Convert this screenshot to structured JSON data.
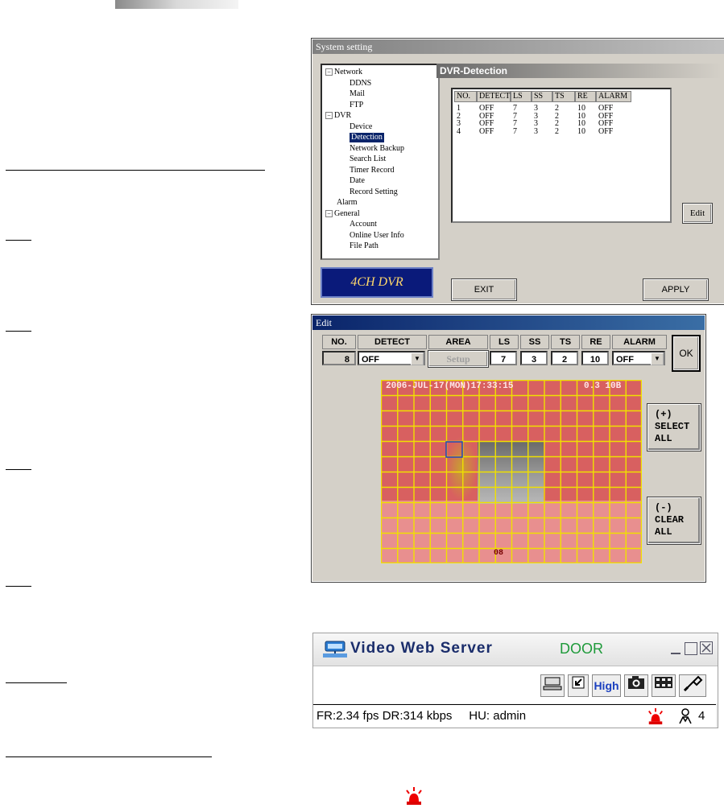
{
  "system_setting": {
    "title": "System setting",
    "tree": [
      {
        "label": "Network",
        "level": 0,
        "expander": "minus"
      },
      {
        "label": "DDNS",
        "level": 2
      },
      {
        "label": "Mail",
        "level": 2
      },
      {
        "label": "FTP",
        "level": 2
      },
      {
        "label": "DVR",
        "level": 0,
        "expander": "minus"
      },
      {
        "label": "Device",
        "level": 2
      },
      {
        "label": "Detection",
        "level": 2,
        "selected": true
      },
      {
        "label": "Network Backup",
        "level": 2
      },
      {
        "label": "Search List",
        "level": 2
      },
      {
        "label": "Timer Record",
        "level": 2
      },
      {
        "label": "Date",
        "level": 2
      },
      {
        "label": "Record Setting",
        "level": 2
      },
      {
        "label": "Alarm",
        "level": 1
      },
      {
        "label": "General",
        "level": 0,
        "expander": "minus"
      },
      {
        "label": "Account",
        "level": 2
      },
      {
        "label": "Online User Info",
        "level": 2
      },
      {
        "label": "File Path",
        "level": 2
      }
    ],
    "logo": "4CH DVR",
    "panel_title": "DVR-Detection",
    "columns": [
      "NO.",
      "DETECT",
      "LS",
      "SS",
      "TS",
      "RE",
      "ALARM"
    ],
    "rows": [
      [
        "1",
        "OFF",
        "7",
        "3",
        "2",
        "10",
        "OFF"
      ],
      [
        "2",
        "OFF",
        "7",
        "3",
        "2",
        "10",
        "OFF"
      ],
      [
        "3",
        "OFF",
        "7",
        "3",
        "2",
        "10",
        "OFF"
      ],
      [
        "4",
        "OFF",
        "7",
        "3",
        "2",
        "10",
        "OFF"
      ]
    ],
    "edit_label": "Edit",
    "exit_label": "EXIT",
    "apply_label": "APPLY"
  },
  "edit_window": {
    "title": "Edit",
    "headers": [
      "NO.",
      "DETECT",
      "AREA",
      "LS",
      "SS",
      "TS",
      "RE",
      "ALARM"
    ],
    "no": "8",
    "detect": "OFF",
    "area_button": "Setup",
    "ls": "7",
    "ss": "3",
    "ts": "2",
    "re": "10",
    "alarm": "OFF",
    "ok_label": "OK",
    "select_all": [
      "(+)",
      "SELECT",
      "ALL"
    ],
    "clear_all": [
      "(-)",
      "CLEAR",
      "ALL"
    ],
    "camera_timestamp": "2006-JUL-17(MON)17:33:15",
    "camera_number": "0.3 10B",
    "camera_bottom_label": "08",
    "grid_color": "#f0e000",
    "overlay_color": "#d86060"
  },
  "video_web_server": {
    "title": "Video Web Server",
    "channel": "DOOR",
    "toolbar": [
      "network-icon",
      "fullscreen-icon",
      "High",
      "snapshot-icon",
      "record-icon",
      "settings-icon"
    ],
    "status": "FR:2.34 fps DR:314 kbps     HU: admin",
    "alarm_icon": "alarm-light-icon",
    "user_count": "4"
  }
}
